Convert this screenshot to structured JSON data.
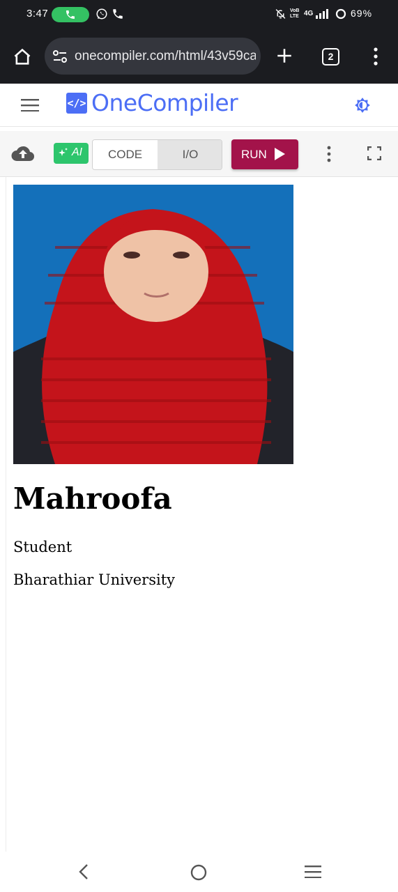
{
  "status_bar": {
    "time": "3:47",
    "battery": "69%",
    "network": "4G",
    "volte": "VoB LTE"
  },
  "browser": {
    "url": "onecompiler.com/html/43v59ca",
    "tab_count": "2"
  },
  "header": {
    "logo_glyph": "</>",
    "logo_text": "OneCompiler",
    "brand_color": "#4c6ef5"
  },
  "toolbar": {
    "ai_label": "AI",
    "code_tab": "CODE",
    "io_tab": "I/O",
    "run_label": "RUN",
    "run_color": "#a3134a",
    "ai_color": "#2dc56c"
  },
  "output": {
    "name": "Mahroofa",
    "role": "Student",
    "university": "Bharathiar University"
  },
  "icons": {
    "status": [
      "phone-call-icon",
      "whatsapp-icon",
      "phone-icon",
      "mute-icon",
      "signal-icon",
      "battery-ring-icon"
    ],
    "browser": [
      "home-icon",
      "site-info-icon",
      "plus-icon",
      "tabs-icon",
      "more-vert-icon"
    ],
    "header": [
      "hamburger-icon",
      "theme-toggle-icon"
    ],
    "toolbar": [
      "cloud-upload-icon",
      "sparkle-icon",
      "play-icon",
      "kebab-icon",
      "fullscreen-icon"
    ],
    "nav": [
      "back-icon",
      "home-circle-icon",
      "recents-icon"
    ]
  }
}
